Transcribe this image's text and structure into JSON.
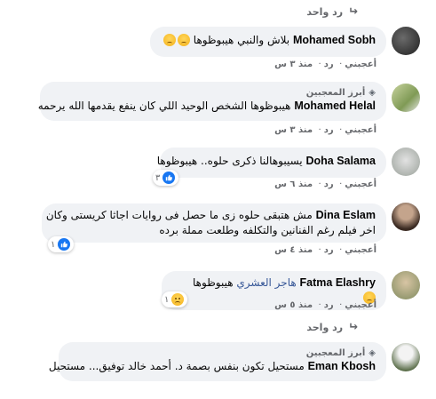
{
  "reply_link_top": "رد واحد",
  "reply_link_bottom": "رد واحد",
  "comments": [
    {
      "name": "Mohamed Sobh",
      "text": "بلاش والنبي هيبوظوها",
      "actions": [
        "أعجبني",
        "رد",
        "منذ ٣ س"
      ]
    },
    {
      "badge": "أبرز المعجبين",
      "name": "Mohamed Helal",
      "text": "هيبوظوها الشخص الوحيد اللي كان ينفع يقدمها الله يرحمه",
      "actions": [
        "أعجبني",
        "رد",
        "منذ ٣ س"
      ]
    },
    {
      "name": "Doha Salama",
      "text1": "يسيبوهالنا ذكرى حلوه.. هيبوظوها",
      "reaction_count": "٣",
      "actions": [
        "أعجبني",
        "رد",
        "منذ ٦ س"
      ]
    },
    {
      "name": "Dina Eslam",
      "text1": "مش هتبقى حلوه زى ما حصل فى روايات اجاثا كريستى وكان",
      "text2": "اخر فيلم رغم الفنانين والتكلفه وطلعت مملة برده",
      "reaction_count": "١",
      "actions": [
        "أعجبني",
        "رد",
        "منذ ٤ س"
      ]
    },
    {
      "name": "Fatma Elashry",
      "text1": "هاجر العشري",
      "text2": "هيبوظوها",
      "reaction_count": "١",
      "actions": [
        "أعجبني",
        "رد",
        "منذ ٥ س"
      ]
    },
    {
      "badge": "أبرز المعجبين",
      "name": "Eman Kbosh",
      "text": "مستحيل تكون بنفس بصمة د. أحمد خالد توفيق... مستحيل"
    }
  ],
  "colors": {
    "bubble_bg": "#f0f2f5",
    "meta_gray": "#65676b",
    "like_blue": "#1877f2"
  }
}
